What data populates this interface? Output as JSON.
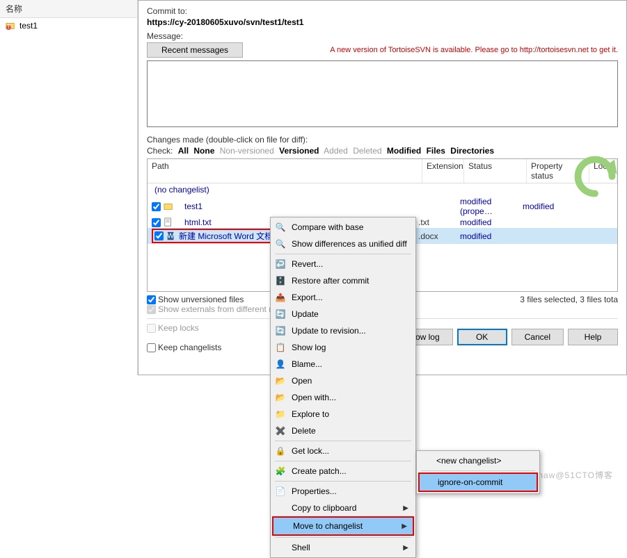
{
  "left": {
    "header": "名称",
    "item": "test1"
  },
  "dialog": {
    "commit_to_label": "Commit to:",
    "commit_url": "https://cy-20180605xuvo/svn/test1/test1",
    "message_label": "Message:",
    "recent_btn": "Recent messages",
    "warning": "A new version of TortoiseSVN is available. Please go to http://tortoisesvn.net to get it.",
    "changes_label": "Changes made (double-click on file for diff):",
    "check": {
      "label": "Check:",
      "all": "All",
      "none": "None",
      "nonversioned": "Non-versioned",
      "versioned": "Versioned",
      "added": "Added",
      "deleted": "Deleted",
      "modified": "Modified",
      "files": "Files",
      "directories": "Directories"
    },
    "columns": {
      "path": "Path",
      "extension": "Extension",
      "status": "Status",
      "property_status": "Property status",
      "lock": "Lock"
    },
    "no_changelist": "(no changelist)",
    "files": [
      {
        "name": "test1",
        "ext": "",
        "status": "modified (prope…",
        "prop": "modified"
      },
      {
        "name": "html.txt",
        "ext": ".txt",
        "status": "modified",
        "prop": ""
      },
      {
        "name": "新建 Microsoft Word 文档.docx",
        "ext": ".docx",
        "status": "modified",
        "prop": ""
      }
    ],
    "show_unversioned": "Show unversioned files",
    "show_externals": "Show externals from different re",
    "files_selected": "3 files selected, 3 files tota",
    "keep_locks": "Keep locks",
    "keep_changelists": "Keep changelists",
    "btn_showlog": "Show log",
    "btn_ok": "OK",
    "btn_cancel": "Cancel",
    "btn_help": "Help"
  },
  "menu": {
    "compare": "Compare with base",
    "diff": "Show differences as unified diff",
    "revert": "Revert...",
    "restore": "Restore after commit",
    "export": "Export...",
    "update": "Update",
    "update_rev": "Update to revision...",
    "showlog": "Show log",
    "blame": "Blame...",
    "open": "Open",
    "openwith": "Open with...",
    "explore": "Explore to",
    "delete": "Delete",
    "getlock": "Get lock...",
    "createpatch": "Create patch...",
    "properties": "Properties...",
    "copy": "Copy to clipboard",
    "move": "Move to changelist",
    "shell": "Shell"
  },
  "submenu": {
    "new_changelist": "<new changelist>",
    "ignore": "ignore-on-commit"
  },
  "watermark": "sinaw@51CTO博客"
}
